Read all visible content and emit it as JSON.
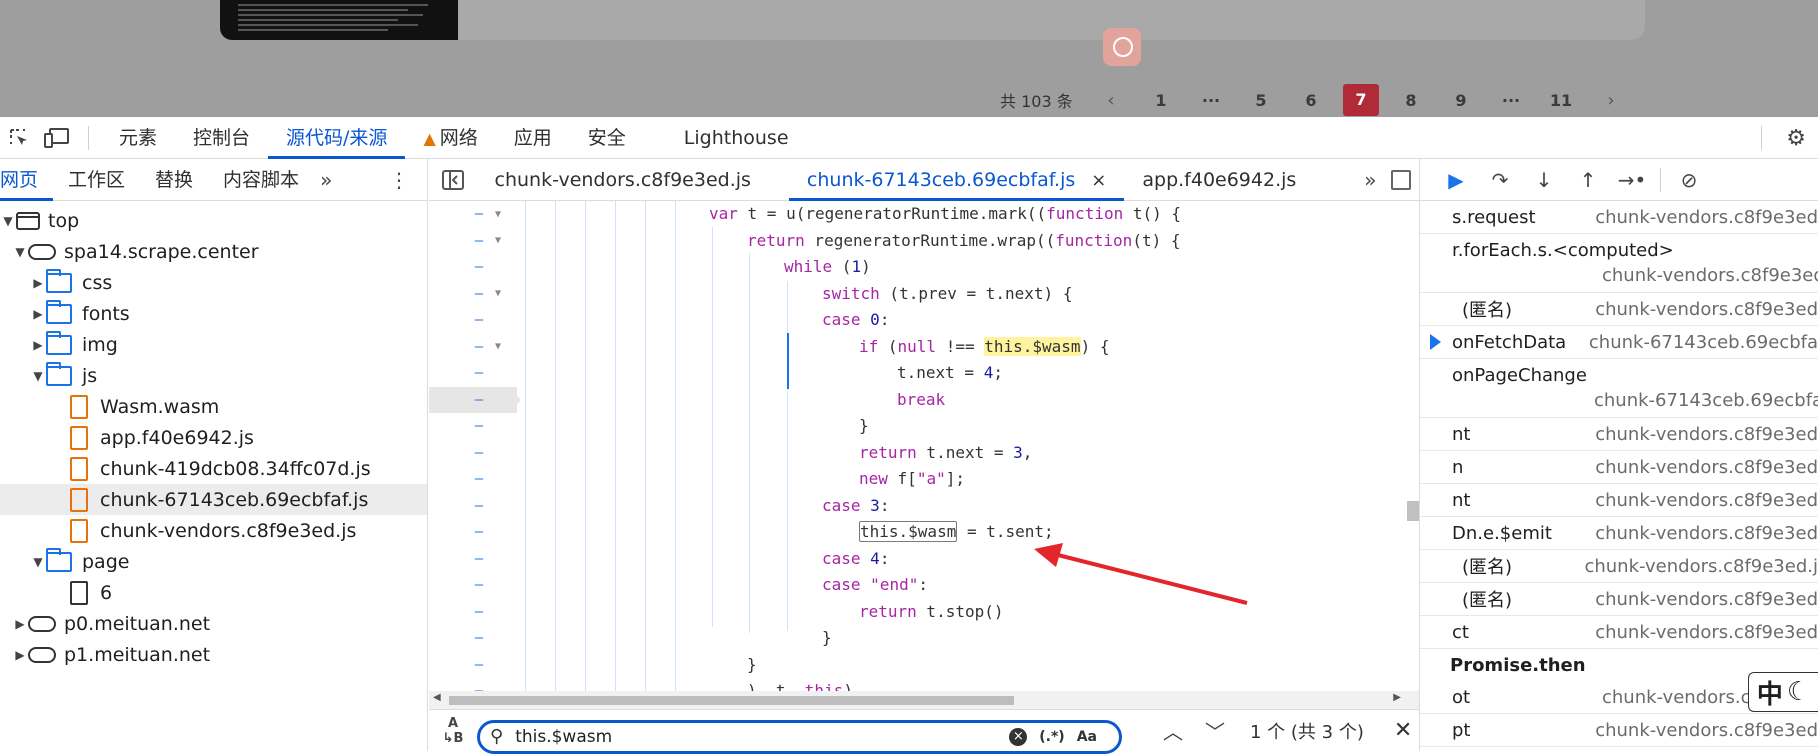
{
  "page": {
    "pager": {
      "total": "共 103 条",
      "prev": "‹",
      "next": "›",
      "pages": [
        "1",
        "···",
        "5",
        "6",
        "7",
        "8",
        "9",
        "···",
        "11"
      ],
      "active": "7"
    }
  },
  "devtools": {
    "tabs": [
      "元素",
      "控制台",
      "源代码/来源",
      "网络",
      "应用",
      "安全",
      "Lighthouse"
    ],
    "active_tab": "源代码/来源"
  },
  "navigator": {
    "tabs": [
      "网页",
      "工作区",
      "替换",
      "内容脚本"
    ],
    "more": "»",
    "tree": {
      "top": "top",
      "origin": "spa14.scrape.center",
      "css": "css",
      "fonts": "fonts",
      "img": "img",
      "js": "js",
      "files": [
        "Wasm.wasm",
        "app.f40e6942.js",
        "chunk-419dcb08.34ffc07d.js",
        "chunk-67143ceb.69ecbfaf.js",
        "chunk-vendors.c8f9e3ed.js"
      ],
      "page": "page",
      "page_file": "6",
      "other_origins": [
        "p0.meituan.net",
        "p1.meituan.net"
      ]
    }
  },
  "editor": {
    "tabs": [
      "chunk-vendors.c8f9e3ed.js",
      "chunk-67143ceb.69ecbfaf.js",
      "app.f40e6942.js"
    ],
    "active_tab": "chunk-67143ceb.69ecbfaf.js",
    "close": "×",
    "more": "»",
    "search": {
      "value": "this.$wasm",
      "regex": "(.*)",
      "case": "Aa",
      "count": "1 个 (共 3 个)"
    }
  },
  "debugger": {
    "frames": [
      {
        "name": "s.request",
        "src": "chunk-vendors.c8f9e3ed"
      },
      {
        "name": "r.forEach.s.<computed>",
        "src": "chunk-vendors.c8f9e3ed"
      },
      {
        "name": "(匿名)",
        "src": "chunk-vendors.c8f9e3ed"
      },
      {
        "name": "onFetchData",
        "src": "chunk-67143ceb.69ecbfa"
      },
      {
        "name": "onPageChange",
        "src": "chunk-67143ceb.69ecbfa"
      },
      {
        "name": "nt",
        "src": "chunk-vendors.c8f9e3ed"
      },
      {
        "name": "n",
        "src": "chunk-vendors.c8f9e3ed"
      },
      {
        "name": "nt",
        "src": "chunk-vendors.c8f9e3ed"
      },
      {
        "name": "Dn.e.$emit",
        "src": "chunk-vendors.c8f9e3ed"
      },
      {
        "name": "(匿名)",
        "src": "chunk-vendors.c8f9e3ed.j"
      },
      {
        "name": "(匿名)",
        "src": "chunk-vendors.c8f9e3ed"
      },
      {
        "name": "ct",
        "src": "chunk-vendors.c8f9e3ed"
      }
    ],
    "async_label": "Promise.then",
    "frames_after": [
      {
        "name": "ot",
        "src": "chunk-vendors.c"
      },
      {
        "name": "pt",
        "src": "chunk-vendors.c8f9e3ed"
      }
    ],
    "ime": "中"
  },
  "code_lines": [
    "var t = u(regeneratorRuntime.mark((function t() {",
    "return regeneratorRuntime.wrap((function(t) {",
    "while (1)",
    "switch (t.prev = t.next) {",
    "case 0:",
    "if (null !== this.$wasm) {",
    "t.next = 4;",
    "break",
    "}",
    "return t.next = 3,",
    "new f[\"a\"];",
    "case 3:",
    "this.$wasm = t.sent;",
    "case 4:",
    "case \"end\":",
    "return t.stop()",
    "}",
    "}",
    "), t, this)"
  ]
}
